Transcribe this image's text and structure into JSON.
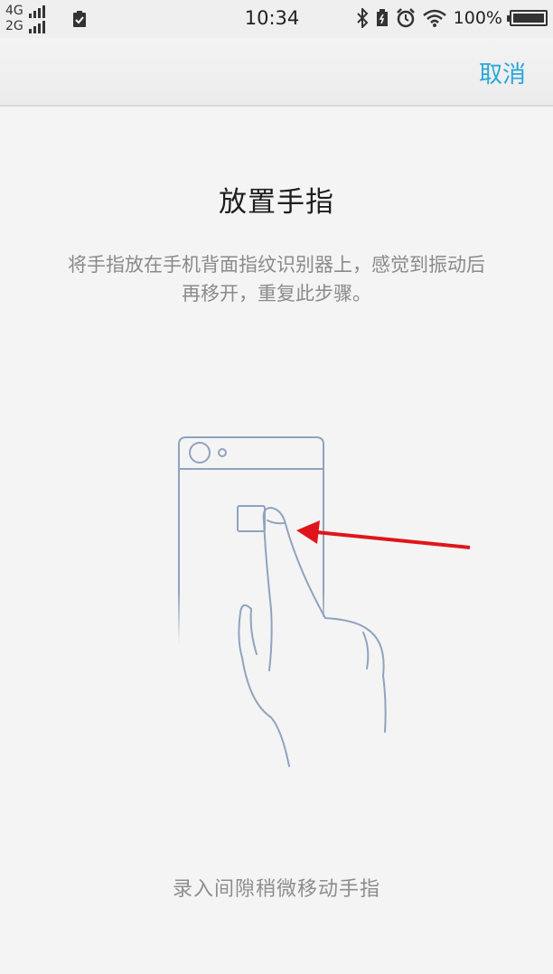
{
  "status_bar": {
    "network_top": "4G",
    "network_bottom": "2G",
    "time": "10:34",
    "battery_percent": "100%",
    "icons": [
      "signal-icon",
      "clipboard-check-icon",
      "bluetooth-icon",
      "battery-saver-icon",
      "alarm-icon",
      "wifi-icon",
      "battery-icon"
    ]
  },
  "header": {
    "cancel_label": "取消"
  },
  "main": {
    "title": "放置手指",
    "description_line1": "将手指放在手机背面指纹识别器上，感觉到振动后",
    "description_line2": "再移开，重复此步骤。",
    "hint": "录入间隙稍微移动手指"
  },
  "colors": {
    "accent": "#2aa7d8",
    "illustration_stroke": "#8fa3bf",
    "arrow": "#e0151b",
    "background": "#f4f4f4"
  }
}
